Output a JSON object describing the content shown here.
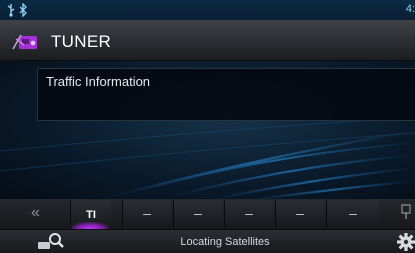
{
  "status_bar": {
    "icons": [
      "usb-icon",
      "bluetooth-icon"
    ],
    "clock": "4:"
  },
  "header": {
    "title": "TUNER",
    "icon": "tuner-icon"
  },
  "main": {
    "info_title": "Traffic Information"
  },
  "tabs": [
    {
      "label": "TI",
      "active": true
    },
    {
      "label": "–",
      "active": false
    },
    {
      "label": "–",
      "active": false
    },
    {
      "label": "–",
      "active": false
    },
    {
      "label": "–",
      "active": false
    },
    {
      "label": "–",
      "active": false
    }
  ],
  "nav": {
    "prev_label": "«",
    "side_icon": "ˁ"
  },
  "bottom_bar": {
    "status_text": "Locating Satellites",
    "left_icon": "search-icon",
    "right_icon": "gear-icon"
  },
  "colors": {
    "accent": "#a62fd8",
    "background": "#0a1b2c",
    "text": "#ffffff"
  }
}
